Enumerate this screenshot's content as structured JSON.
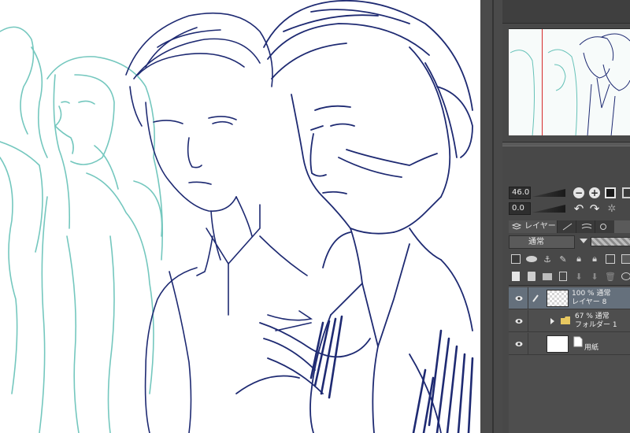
{
  "canvas": {
    "line_colors": {
      "navy": "#1e2a72",
      "teal": "#66c2b8"
    }
  },
  "navigator": {
    "frame_color": "#d62a2a"
  },
  "zoom": {
    "zoom_value": "46.0",
    "rotate_value": "0.0",
    "icons": [
      "zoom-out-icon",
      "zoom-in-icon",
      "fit-view-icon",
      "rotate-left-icon",
      "rotate-right-icon",
      "reset-rotation-icon"
    ]
  },
  "layer_panel": {
    "tab_label": "レイヤー",
    "blend_mode": "通常",
    "layers": [
      {
        "line1": "100 % 通常",
        "line2": "レイヤー 8",
        "selected": true,
        "type": "raster"
      },
      {
        "line1": "67 % 通常",
        "line2": "フォルダー 1",
        "selected": false,
        "type": "folder"
      },
      {
        "line1": "",
        "line2": "用紙",
        "selected": false,
        "type": "paper"
      }
    ]
  },
  "colors": {
    "panel_bg": "#484848",
    "selected_layer": "#65707c",
    "accent_red": "#d62a2a"
  }
}
